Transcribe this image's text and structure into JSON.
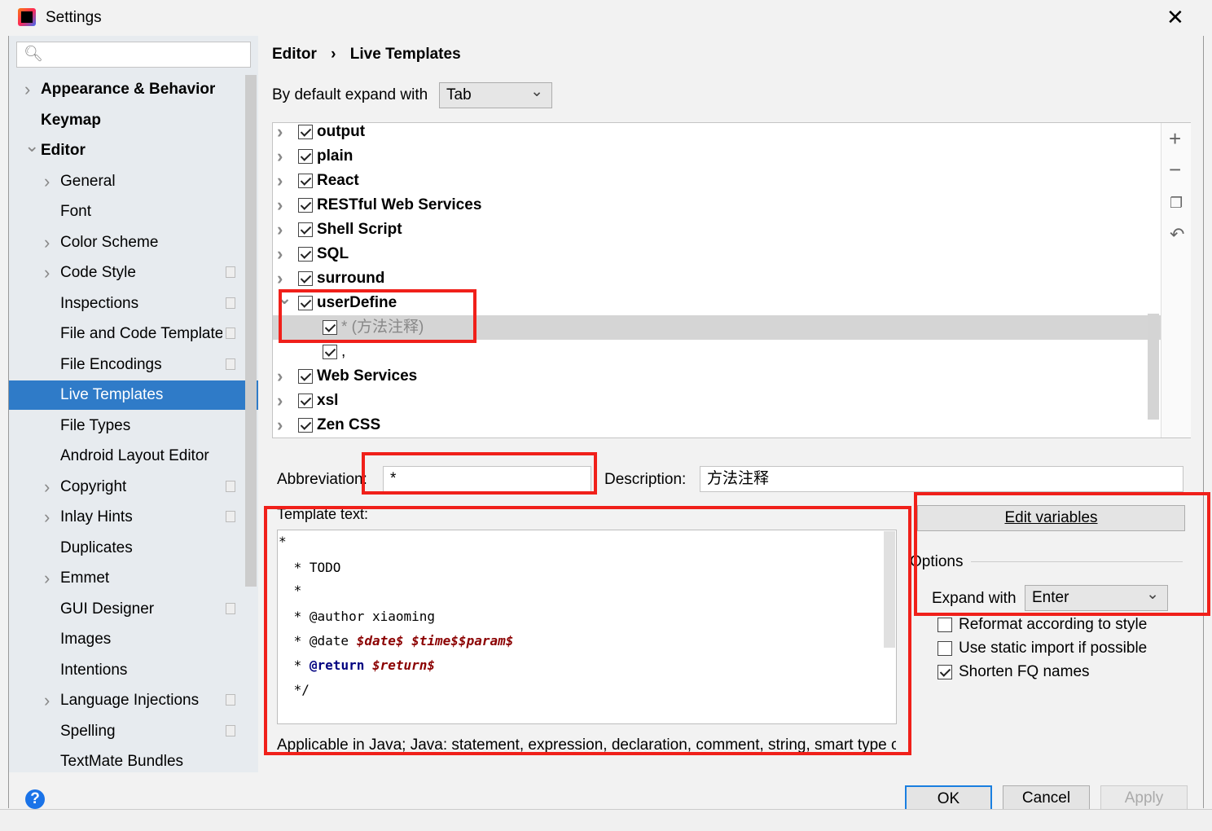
{
  "window": {
    "title": "Settings",
    "close_icon": "close-icon"
  },
  "search": {
    "placeholder": ""
  },
  "sidebar": {
    "items": [
      {
        "label": "Appearance & Behavior",
        "bold": true,
        "chevron": "right",
        "level": 0
      },
      {
        "label": "Keymap",
        "bold": true,
        "level": 0
      },
      {
        "label": "Editor",
        "bold": true,
        "chevron": "down",
        "level": 0
      },
      {
        "label": "General",
        "chevron": "right",
        "level": 1
      },
      {
        "label": "Font",
        "level": 1
      },
      {
        "label": "Color Scheme",
        "chevron": "right",
        "level": 1
      },
      {
        "label": "Code Style",
        "chevron": "right",
        "level": 1,
        "copy": true
      },
      {
        "label": "Inspections",
        "level": 1,
        "copy": true
      },
      {
        "label": "File and Code Templates",
        "level": 1,
        "copy": true
      },
      {
        "label": "File Encodings",
        "level": 1,
        "copy": true
      },
      {
        "label": "Live Templates",
        "level": 1,
        "selected": true
      },
      {
        "label": "File Types",
        "level": 1
      },
      {
        "label": "Android Layout Editor",
        "level": 1
      },
      {
        "label": "Copyright",
        "chevron": "right",
        "level": 1,
        "copy": true
      },
      {
        "label": "Inlay Hints",
        "chevron": "right",
        "level": 1,
        "copy": true
      },
      {
        "label": "Duplicates",
        "level": 1
      },
      {
        "label": "Emmet",
        "chevron": "right",
        "level": 1
      },
      {
        "label": "GUI Designer",
        "level": 1,
        "copy": true
      },
      {
        "label": "Images",
        "level": 1
      },
      {
        "label": "Intentions",
        "level": 1
      },
      {
        "label": "Language Injections",
        "chevron": "right",
        "level": 1,
        "copy": true
      },
      {
        "label": "Spelling",
        "level": 1,
        "copy": true
      },
      {
        "label": "TextMate Bundles",
        "level": 1
      }
    ]
  },
  "breadcrumb": {
    "parent": "Editor",
    "sep": "›",
    "current": "Live Templates"
  },
  "expand_default": {
    "label": "By default expand with",
    "value": "Tab"
  },
  "tree": [
    {
      "label": "output",
      "checked": true,
      "chevron": "right"
    },
    {
      "label": "plain",
      "checked": true,
      "chevron": "right"
    },
    {
      "label": "React",
      "checked": true,
      "chevron": "right"
    },
    {
      "label": "RESTful Web Services",
      "checked": true,
      "chevron": "right"
    },
    {
      "label": "Shell Script",
      "checked": true,
      "chevron": "right"
    },
    {
      "label": "SQL",
      "checked": true,
      "chevron": "right"
    },
    {
      "label": "surround",
      "checked": true,
      "chevron": "right"
    },
    {
      "label": "userDefine",
      "checked": true,
      "chevron": "down"
    },
    {
      "label": "* (方法注释)",
      "checked": true,
      "child": true,
      "selected": true
    },
    {
      "label": ",",
      "checked": true,
      "child": true
    },
    {
      "label": "Web Services",
      "checked": true,
      "chevron": "right"
    },
    {
      "label": "xsl",
      "checked": true,
      "chevron": "right"
    },
    {
      "label": "Zen CSS",
      "checked": true,
      "chevron": "right"
    }
  ],
  "tree_tools": {
    "add": "+",
    "remove": "−",
    "copy_icon": "copy-icon",
    "revert_icon": "undo-icon"
  },
  "abbreviation": {
    "label": "Abbreviation:",
    "value": "*"
  },
  "description": {
    "label": "Description:",
    "value": "方法注释"
  },
  "template_text": {
    "label": "Template text:",
    "lines": [
      "*",
      " * TODO",
      " *",
      " * @author xiaoming",
      " * @date ",
      "$date$ $time$$param$",
      " * ",
      "@return",
      " ",
      "$return$",
      " */"
    ]
  },
  "applicable": "Applicable in Java; Java: statement, expression, declaration, comment, string, smart type c",
  "edit_variables": "Edit variables",
  "options": {
    "title": "Options",
    "expand_label": "Expand with",
    "expand_value": "Enter",
    "checks": [
      {
        "label": "Reformat according to style",
        "checked": false
      },
      {
        "label": "Use static import if possible",
        "checked": false
      },
      {
        "label": "Shorten FQ names",
        "checked": true
      }
    ]
  },
  "footer": {
    "help": "?",
    "ok": "OK",
    "cancel": "Cancel",
    "apply": "Apply"
  },
  "colors": {
    "selection": "#2f7bc8",
    "annotation": "#f0201a",
    "variable": "#8b0000",
    "keyword": "#000080"
  }
}
